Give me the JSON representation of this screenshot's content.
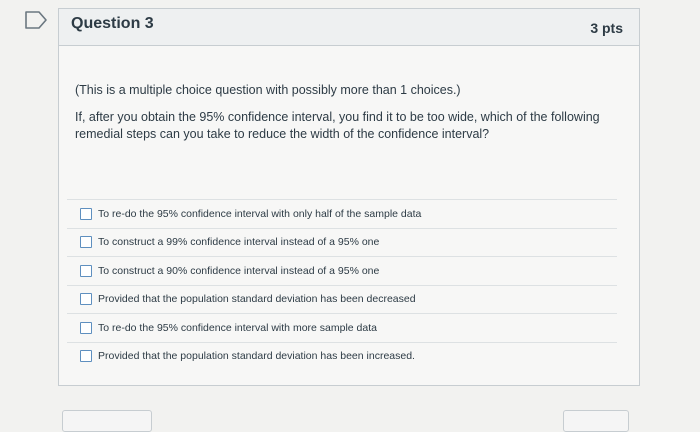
{
  "icons": {
    "flag": "flag-icon",
    "checkbox": "checkbox-icon"
  },
  "colors": {
    "header_bg": "#eef0f1",
    "card_bg": "#f7f7f6",
    "border": "#c7cdd1",
    "checkbox_border": "#5e8fbf",
    "text": "#2d3b45"
  },
  "question": {
    "title": "Question 3",
    "points": "3 pts",
    "instruction": "(This is a multiple choice question with possibly more than 1 choices.)",
    "text": "If, after you obtain the 95% confidence interval, you find it to be too wide, which of the following remedial steps can you take to reduce the width of the confidence interval?"
  },
  "answers": [
    {
      "label": "To re-do the 95% confidence interval with only half of the sample data",
      "checked": false
    },
    {
      "label": "To construct a 99% confidence interval instead of a 95% one",
      "checked": false
    },
    {
      "label": "To construct a 90% confidence interval instead of a 95% one",
      "checked": false
    },
    {
      "label": "Provided that the population standard deviation has been decreased",
      "checked": false
    },
    {
      "label": "To re-do the 95% confidence interval with more sample data",
      "checked": false
    },
    {
      "label": "Provided that the population standard deviation has been increased.",
      "checked": false
    }
  ]
}
